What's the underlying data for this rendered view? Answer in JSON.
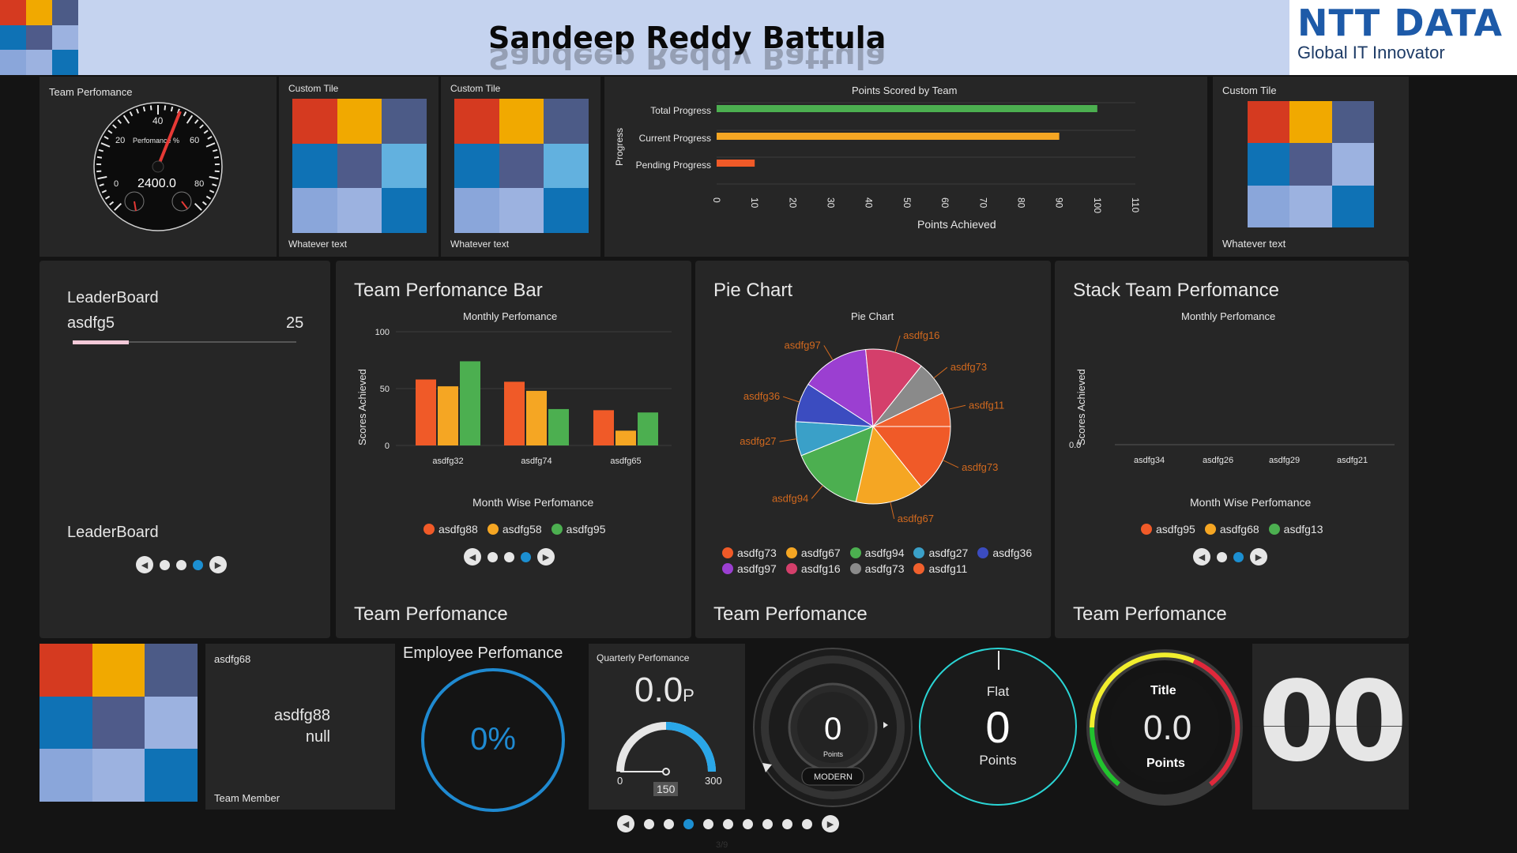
{
  "header": {
    "title": "Sandeep Reddy Battula"
  },
  "logo": {
    "brand": "NTT DATA",
    "tagline": "Global IT Innovator"
  },
  "row1": {
    "gauge": {
      "label": "Team Perfomance",
      "value": "2400.0",
      "inner_label": "Perfomance %",
      "ticks": [
        "0",
        "20",
        "40",
        "60",
        "80"
      ]
    },
    "custom1": {
      "label": "Custom Tile",
      "footer": "Whatever text"
    },
    "custom2": {
      "label": "Custom Tile",
      "footer": "Whatever text"
    },
    "custom3": {
      "label": "Custom Tile",
      "footer": "Whatever text"
    },
    "hbar": {
      "title": "Points Scored by Team",
      "ylabel": "Progress",
      "xlabel": "Points Achieved",
      "ticks": [
        "0",
        "10",
        "20",
        "30",
        "40",
        "50",
        "60",
        "70",
        "80",
        "90",
        "100",
        "110"
      ]
    }
  },
  "leaderboard": {
    "title": "LeaderBoard",
    "name": "asdfg5",
    "score": "25",
    "footer": "LeaderBoard",
    "progress": 0.25
  },
  "bar_panel": {
    "title": "Team Perfomance Bar",
    "chart_title": "Monthly Perfomance",
    "ylabel": "Scores Achieved",
    "xlabel": "Month Wise Perfomance",
    "footer": "Team Perfomance"
  },
  "pie_panel": {
    "title": "Pie Chart",
    "chart_title": "Pie Chart",
    "footer": "Team Perfomance"
  },
  "stack_panel": {
    "title": "Stack Team Perfomance",
    "chart_title": "Monthly Perfomance",
    "ylabel": "Scores Achieved",
    "xlabel": "Month Wise Perfomance",
    "footer": "Team Perfomance",
    "ytick": "0.0",
    "categories": [
      "asdfg34",
      "asdfg26",
      "asdfg29",
      "asdfg21"
    ],
    "legend": [
      {
        "name": "asdfg95",
        "color": "#f05a28"
      },
      {
        "name": "asdfg68",
        "color": "#f5a623"
      },
      {
        "name": "asdfg13",
        "color": "#4caf50"
      }
    ]
  },
  "row3": {
    "member": {
      "header": "asdfg68",
      "line1": "asdfg88",
      "line2": "null",
      "footer": "Team Member"
    },
    "employee": {
      "title": "Employee Perfomance",
      "value": "0%"
    },
    "quarterly": {
      "title": "Quarterly Perfomance",
      "value": "0.0",
      "unit": "P",
      "min": "0",
      "max": "300",
      "current": "150"
    },
    "modern": {
      "value": "0",
      "unit": "Points",
      "badge": "MODERN"
    },
    "flat": {
      "title": "Flat",
      "value": "0",
      "unit": "Points"
    },
    "title_gauge": {
      "title": "Title",
      "value": "0.0",
      "unit": "Points"
    },
    "flip": {
      "value": "00"
    }
  },
  "pager": {
    "label": "3/9"
  },
  "chart_data": [
    {
      "type": "bar",
      "title": "Points Scored by Team",
      "orientation": "horizontal",
      "categories": [
        "Total Progress",
        "Current Progress",
        "Pending Progress"
      ],
      "values": [
        100,
        90,
        10
      ],
      "colors": [
        "#4caf50",
        "#f5a623",
        "#f05a28"
      ],
      "xlabel": "Points Achieved",
      "ylabel": "Progress",
      "xlim": [
        0,
        110
      ]
    },
    {
      "type": "bar",
      "title": "Monthly Perfomance",
      "categories": [
        "asdfg32",
        "asdfg74",
        "asdfg65"
      ],
      "series": [
        {
          "name": "asdfg88",
          "color": "#f05a28",
          "values": [
            58,
            56,
            31
          ]
        },
        {
          "name": "asdfg58",
          "color": "#f5a623",
          "values": [
            52,
            48,
            13
          ]
        },
        {
          "name": "asdfg95",
          "color": "#4caf50",
          "values": [
            74,
            32,
            29
          ]
        }
      ],
      "xlabel": "Month Wise Perfomance",
      "ylabel": "Scores Achieved",
      "ylim": [
        0,
        100
      ],
      "yticks": [
        0,
        50,
        100
      ]
    },
    {
      "type": "pie",
      "title": "Pie Chart",
      "slices": [
        {
          "name": "asdfg73",
          "color": "#f05a28",
          "value": 14
        },
        {
          "name": "asdfg67",
          "color": "#f5a623",
          "value": 14
        },
        {
          "name": "asdfg94",
          "color": "#4caf50",
          "value": 15
        },
        {
          "name": "asdfg27",
          "color": "#3aa0c8",
          "value": 7
        },
        {
          "name": "asdfg36",
          "color": "#3b4cc0",
          "value": 8
        },
        {
          "name": "asdfg97",
          "color": "#9b3fd1",
          "value": 14
        },
        {
          "name": "asdfg16",
          "color": "#d43f6b",
          "value": 12
        },
        {
          "name": "asdfg73",
          "color": "#8a8a8a",
          "value": 7
        },
        {
          "name": "asdfg11",
          "color": "#f0602d",
          "value": 7
        }
      ]
    }
  ]
}
